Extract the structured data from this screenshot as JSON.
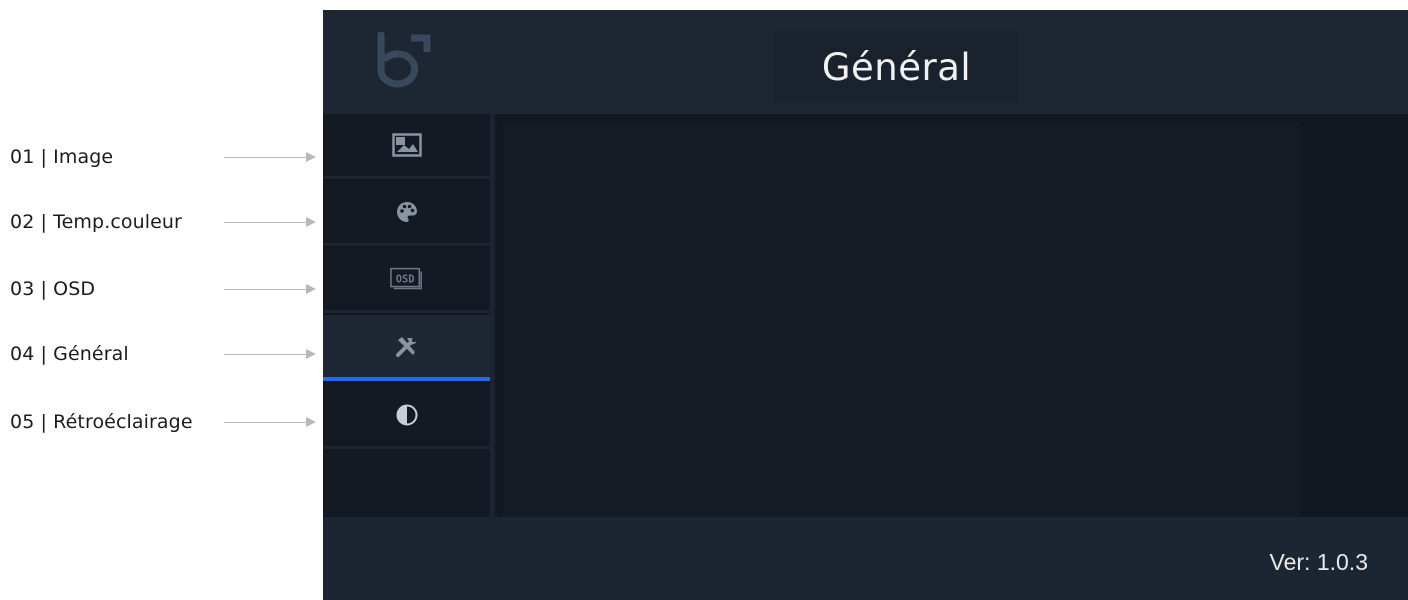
{
  "annotations": [
    {
      "label": "01 | Image"
    },
    {
      "label": "02 | Temp.couleur"
    },
    {
      "label": "03 | OSD"
    },
    {
      "label": "04 | Général"
    },
    {
      "label": "05 | Rétroéclairage"
    }
  ],
  "header": {
    "logo": "brand-logo",
    "title": "Général"
  },
  "sidebar": {
    "items": [
      {
        "id": "image",
        "icon": "picture-icon",
        "active": false
      },
      {
        "id": "temp-couleur",
        "icon": "palette-icon",
        "active": false
      },
      {
        "id": "osd",
        "icon": "osd-icon",
        "active": false,
        "icon_text": "OSD"
      },
      {
        "id": "general",
        "icon": "tools-icon",
        "active": true
      },
      {
        "id": "retroeclairage",
        "icon": "half-circle-icon",
        "active": false
      }
    ]
  },
  "footer": {
    "version": "Ver: 1.0.3"
  },
  "colors": {
    "accent": "#1d6df0",
    "osd_background": "#1c2633",
    "body_background": "#121821",
    "icon": "#8a93a0"
  }
}
